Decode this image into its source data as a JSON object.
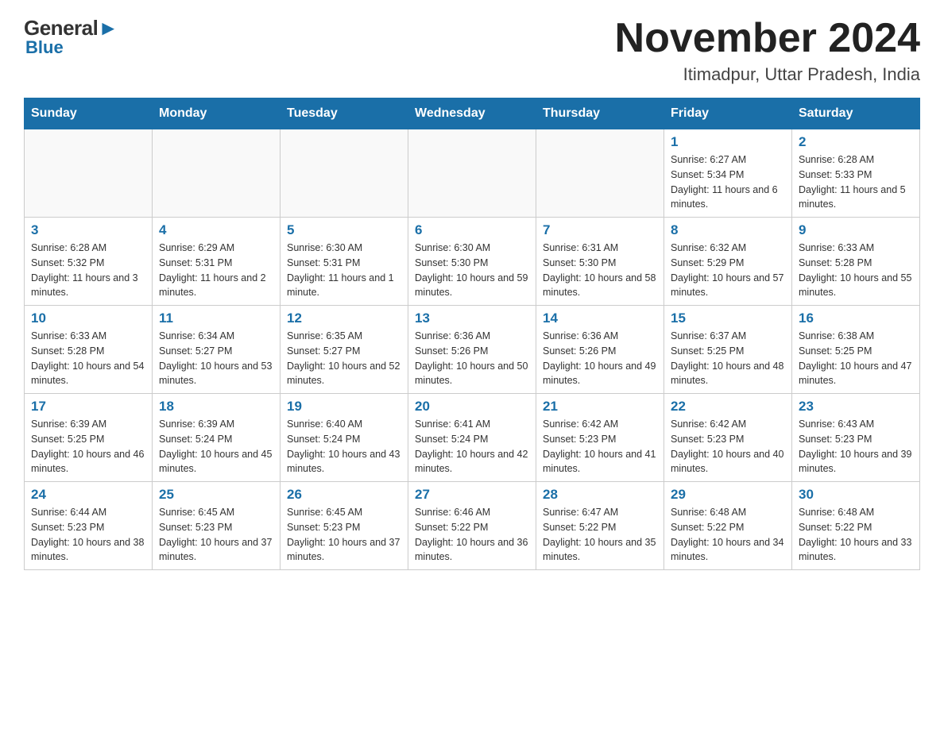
{
  "logo": {
    "general": "General",
    "blue": "Blue"
  },
  "title": {
    "month_year": "November 2024",
    "location": "Itimadpur, Uttar Pradesh, India"
  },
  "weekdays": [
    "Sunday",
    "Monday",
    "Tuesday",
    "Wednesday",
    "Thursday",
    "Friday",
    "Saturday"
  ],
  "weeks": [
    [
      {
        "day": "",
        "info": ""
      },
      {
        "day": "",
        "info": ""
      },
      {
        "day": "",
        "info": ""
      },
      {
        "day": "",
        "info": ""
      },
      {
        "day": "",
        "info": ""
      },
      {
        "day": "1",
        "info": "Sunrise: 6:27 AM\nSunset: 5:34 PM\nDaylight: 11 hours and 6 minutes."
      },
      {
        "day": "2",
        "info": "Sunrise: 6:28 AM\nSunset: 5:33 PM\nDaylight: 11 hours and 5 minutes."
      }
    ],
    [
      {
        "day": "3",
        "info": "Sunrise: 6:28 AM\nSunset: 5:32 PM\nDaylight: 11 hours and 3 minutes."
      },
      {
        "day": "4",
        "info": "Sunrise: 6:29 AM\nSunset: 5:31 PM\nDaylight: 11 hours and 2 minutes."
      },
      {
        "day": "5",
        "info": "Sunrise: 6:30 AM\nSunset: 5:31 PM\nDaylight: 11 hours and 1 minute."
      },
      {
        "day": "6",
        "info": "Sunrise: 6:30 AM\nSunset: 5:30 PM\nDaylight: 10 hours and 59 minutes."
      },
      {
        "day": "7",
        "info": "Sunrise: 6:31 AM\nSunset: 5:30 PM\nDaylight: 10 hours and 58 minutes."
      },
      {
        "day": "8",
        "info": "Sunrise: 6:32 AM\nSunset: 5:29 PM\nDaylight: 10 hours and 57 minutes."
      },
      {
        "day": "9",
        "info": "Sunrise: 6:33 AM\nSunset: 5:28 PM\nDaylight: 10 hours and 55 minutes."
      }
    ],
    [
      {
        "day": "10",
        "info": "Sunrise: 6:33 AM\nSunset: 5:28 PM\nDaylight: 10 hours and 54 minutes."
      },
      {
        "day": "11",
        "info": "Sunrise: 6:34 AM\nSunset: 5:27 PM\nDaylight: 10 hours and 53 minutes."
      },
      {
        "day": "12",
        "info": "Sunrise: 6:35 AM\nSunset: 5:27 PM\nDaylight: 10 hours and 52 minutes."
      },
      {
        "day": "13",
        "info": "Sunrise: 6:36 AM\nSunset: 5:26 PM\nDaylight: 10 hours and 50 minutes."
      },
      {
        "day": "14",
        "info": "Sunrise: 6:36 AM\nSunset: 5:26 PM\nDaylight: 10 hours and 49 minutes."
      },
      {
        "day": "15",
        "info": "Sunrise: 6:37 AM\nSunset: 5:25 PM\nDaylight: 10 hours and 48 minutes."
      },
      {
        "day": "16",
        "info": "Sunrise: 6:38 AM\nSunset: 5:25 PM\nDaylight: 10 hours and 47 minutes."
      }
    ],
    [
      {
        "day": "17",
        "info": "Sunrise: 6:39 AM\nSunset: 5:25 PM\nDaylight: 10 hours and 46 minutes."
      },
      {
        "day": "18",
        "info": "Sunrise: 6:39 AM\nSunset: 5:24 PM\nDaylight: 10 hours and 45 minutes."
      },
      {
        "day": "19",
        "info": "Sunrise: 6:40 AM\nSunset: 5:24 PM\nDaylight: 10 hours and 43 minutes."
      },
      {
        "day": "20",
        "info": "Sunrise: 6:41 AM\nSunset: 5:24 PM\nDaylight: 10 hours and 42 minutes."
      },
      {
        "day": "21",
        "info": "Sunrise: 6:42 AM\nSunset: 5:23 PM\nDaylight: 10 hours and 41 minutes."
      },
      {
        "day": "22",
        "info": "Sunrise: 6:42 AM\nSunset: 5:23 PM\nDaylight: 10 hours and 40 minutes."
      },
      {
        "day": "23",
        "info": "Sunrise: 6:43 AM\nSunset: 5:23 PM\nDaylight: 10 hours and 39 minutes."
      }
    ],
    [
      {
        "day": "24",
        "info": "Sunrise: 6:44 AM\nSunset: 5:23 PM\nDaylight: 10 hours and 38 minutes."
      },
      {
        "day": "25",
        "info": "Sunrise: 6:45 AM\nSunset: 5:23 PM\nDaylight: 10 hours and 37 minutes."
      },
      {
        "day": "26",
        "info": "Sunrise: 6:45 AM\nSunset: 5:23 PM\nDaylight: 10 hours and 37 minutes."
      },
      {
        "day": "27",
        "info": "Sunrise: 6:46 AM\nSunset: 5:22 PM\nDaylight: 10 hours and 36 minutes."
      },
      {
        "day": "28",
        "info": "Sunrise: 6:47 AM\nSunset: 5:22 PM\nDaylight: 10 hours and 35 minutes."
      },
      {
        "day": "29",
        "info": "Sunrise: 6:48 AM\nSunset: 5:22 PM\nDaylight: 10 hours and 34 minutes."
      },
      {
        "day": "30",
        "info": "Sunrise: 6:48 AM\nSunset: 5:22 PM\nDaylight: 10 hours and 33 minutes."
      }
    ]
  ]
}
